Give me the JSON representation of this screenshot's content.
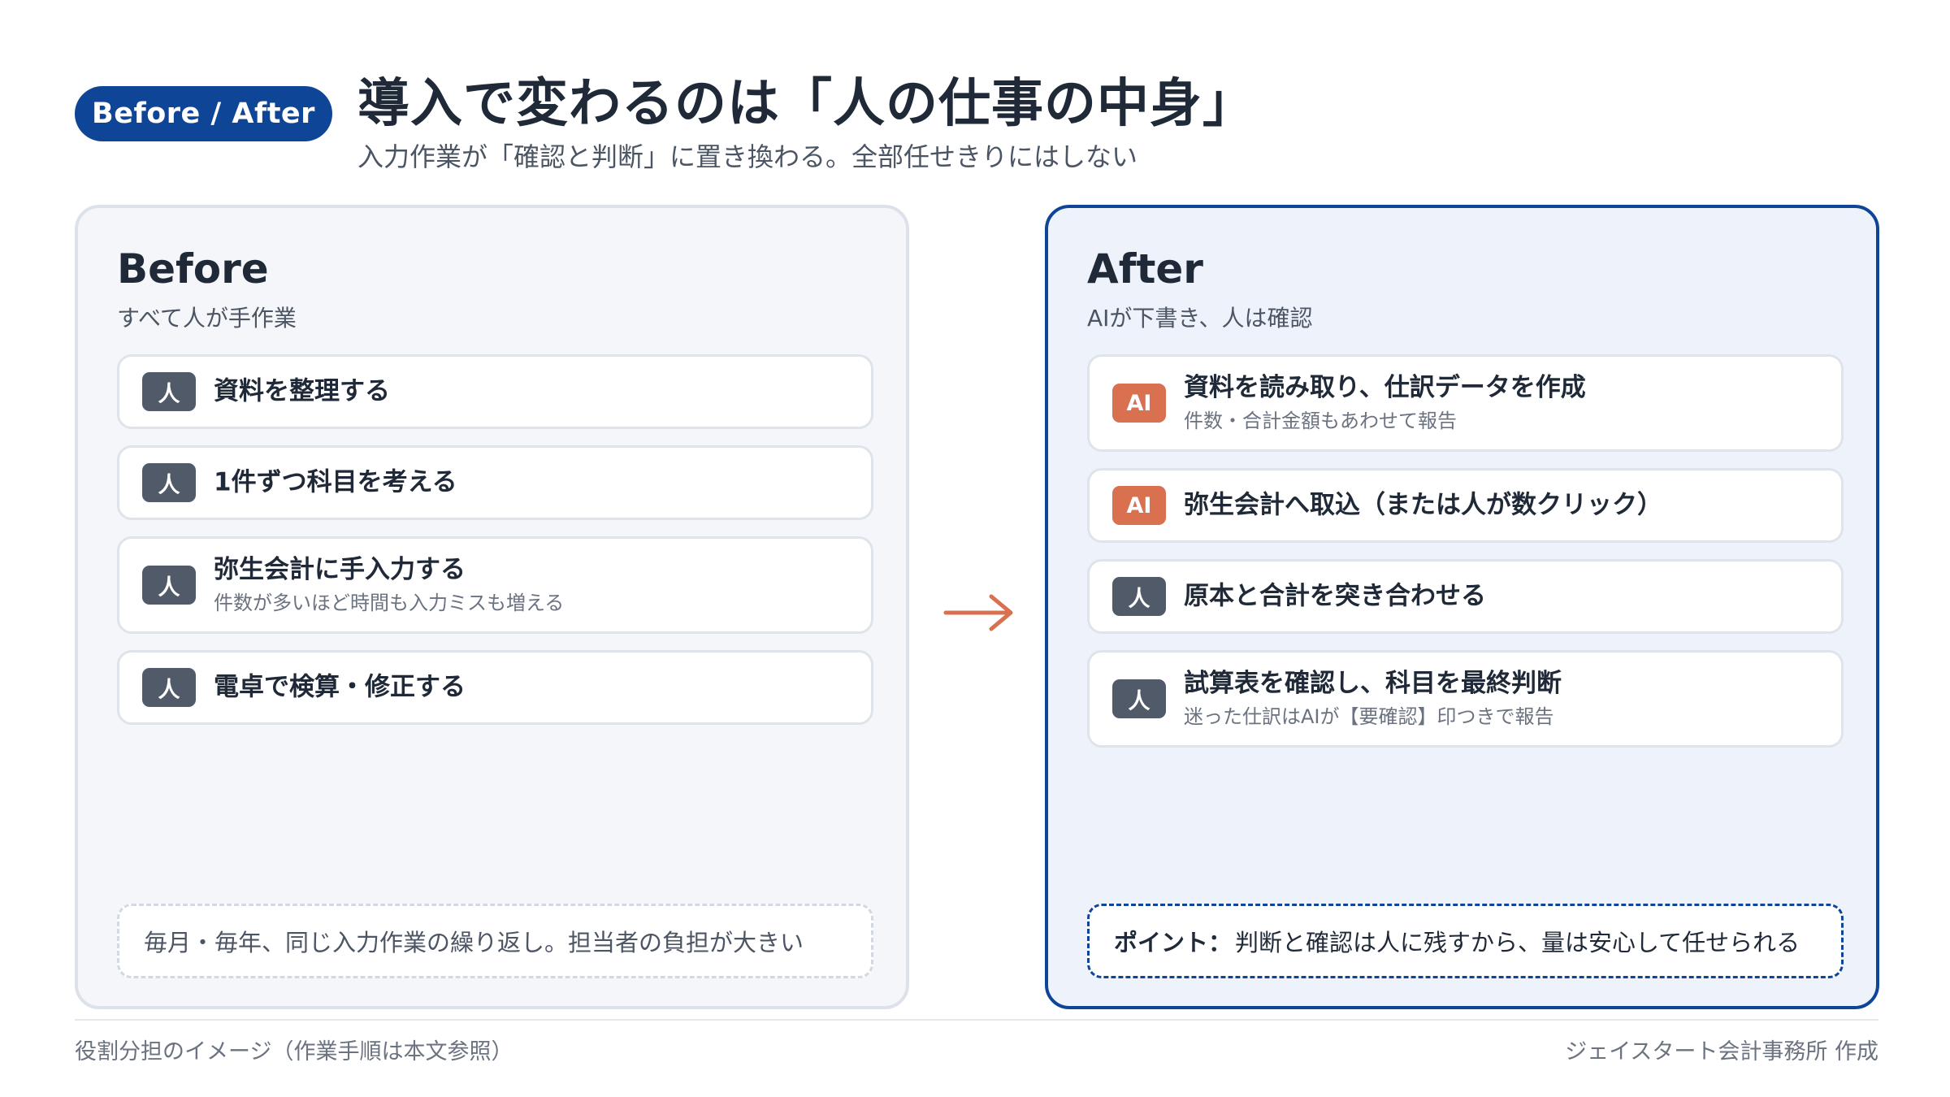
{
  "header": {
    "tag": "Before / After",
    "title": "導入で変わるのは「人の仕事の中身」",
    "subtitle": "入力作業が「確認と判断」に置き換わる。全部任せきりにはしない"
  },
  "before": {
    "title": "Before",
    "subtitle": "すべて人が手作業",
    "items": [
      {
        "badge": "人",
        "label": "資料を整理する",
        "note": ""
      },
      {
        "badge": "人",
        "label": "1件ずつ科目を考える",
        "note": ""
      },
      {
        "badge": "人",
        "label": "弥生会計に手入力する",
        "note": "件数が多いほど時間も入力ミスも増える"
      },
      {
        "badge": "人",
        "label": "電卓で検算・修正する",
        "note": ""
      }
    ],
    "note": "毎月・毎年、同じ入力作業の繰り返し。担当者の負担が大きい"
  },
  "after": {
    "title": "After",
    "subtitle": "AIが下書き、人は確認",
    "items": [
      {
        "badge": "AI",
        "label": "資料を読み取り、仕訳データを作成",
        "note": "件数・合計金額もあわせて報告"
      },
      {
        "badge": "AI",
        "label": "弥生会計へ取込（または人が数クリック）",
        "note": ""
      },
      {
        "badge": "人",
        "label": "原本と合計を突き合わせる",
        "note": ""
      },
      {
        "badge": "人",
        "label": "試算表を確認し、科目を最終判断",
        "note": "迷った仕訳はAIが【要確認】印つきで報告"
      }
    ],
    "note_strong": "ポイント：",
    "note": "判断と確認は人に残すから、量は安心して任せられる"
  },
  "footer": {
    "left": "役割分担のイメージ（作業手順は本文参照）",
    "right": "ジェイスタート会計事務所 作成"
  },
  "colors": {
    "brand": "#0f4596",
    "ai_badge": "#d9704f",
    "person_badge": "#505a69",
    "arrow": "#d9704f"
  },
  "icons": {
    "arrow": "right-arrow-icon"
  }
}
